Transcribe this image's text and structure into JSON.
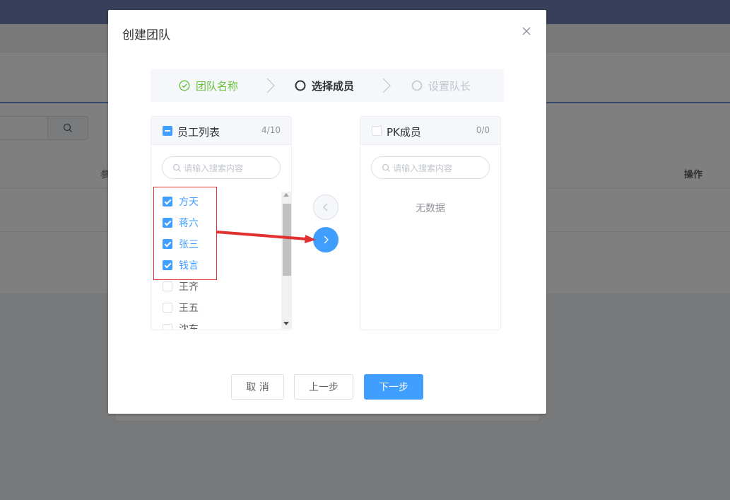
{
  "background": {
    "table_header_left": "参",
    "table_header_right": "操作"
  },
  "dialog": {
    "title": "创建团队"
  },
  "steps": [
    {
      "label": "团队名称",
      "status": "done"
    },
    {
      "label": "选择成员",
      "status": "active"
    },
    {
      "label": "设置队长",
      "status": "pending"
    }
  ],
  "left_panel": {
    "title": "员工列表",
    "count": "4/10",
    "search_placeholder": "请输入搜索内容",
    "items": [
      {
        "label": "方天",
        "checked": true
      },
      {
        "label": "蒋六",
        "checked": true
      },
      {
        "label": "张三",
        "checked": true
      },
      {
        "label": "钱言",
        "checked": true
      },
      {
        "label": "王齐",
        "checked": false
      },
      {
        "label": "王五",
        "checked": false
      },
      {
        "label": "沈东",
        "checked": false
      }
    ]
  },
  "right_panel": {
    "title": "PK成员",
    "count": "0/0",
    "search_placeholder": "请输入搜索内容",
    "empty_text": "无数据"
  },
  "footer": {
    "cancel_label": "取 消",
    "prev_label": "上一步",
    "next_label": "下一步"
  },
  "colors": {
    "primary": "#409eff",
    "success": "#67c23a",
    "annotation": "#e03030"
  }
}
